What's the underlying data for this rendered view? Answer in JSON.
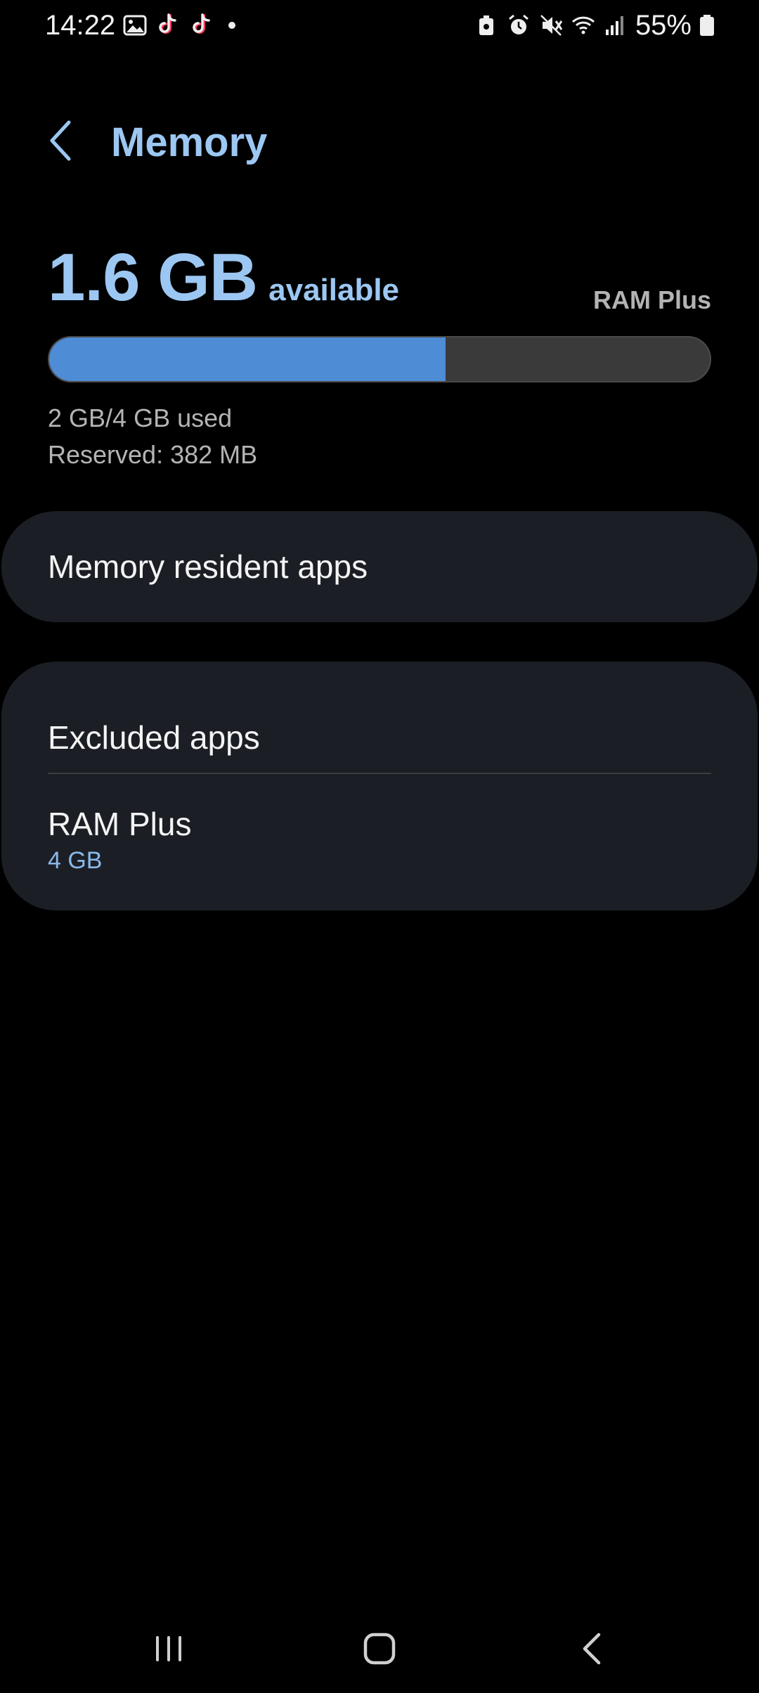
{
  "status_bar": {
    "time": "14:22",
    "left_icons": [
      "gallery-icon",
      "tiktok-icon",
      "tiktok-icon",
      "dot-icon"
    ],
    "right_icons": [
      "lock-battery-icon",
      "alarm-icon",
      "mute-icon",
      "wifi-icon",
      "signal-icon"
    ],
    "battery_percent": "55%"
  },
  "header": {
    "title": "Memory",
    "back_icon": "chevron-left-icon"
  },
  "summary": {
    "available_value": "1.6 GB",
    "available_label": "available",
    "ram_plus_tag": "RAM Plus",
    "used_text": "2 GB/4 GB used",
    "reserved_text": "Reserved: 382 MB",
    "used_fraction": 0.6,
    "bar_fill_color": "#4e8cd6",
    "bar_track_color": "#3a3a3a"
  },
  "cards": {
    "memory_resident_apps": "Memory resident apps",
    "excluded_apps": "Excluded apps",
    "ram_plus": {
      "label": "RAM Plus",
      "value": "4 GB"
    }
  },
  "nav_bar": {
    "recent_icon": "recent-apps-icon",
    "home_icon": "home-icon",
    "back_icon": "back-icon"
  },
  "colors": {
    "accent": "#9cc7f2",
    "background": "#000000",
    "card": "#1b1f25"
  }
}
